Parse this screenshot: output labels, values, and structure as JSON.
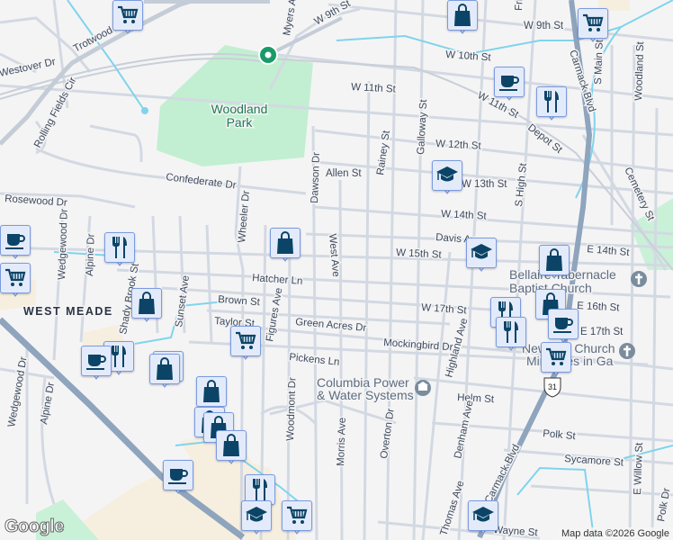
{
  "map": {
    "park_name_line1": "Woodland",
    "park_name_line2": "Park",
    "area_name": "WEST MEADE",
    "poi": {
      "power_line1": "Columbia Power",
      "power_line2": "& Water Systems",
      "church1_line1": "Bellaire Tabernacle",
      "church1_line2": "Baptist Church",
      "church2_line1": "New Life Church",
      "church2_line2": "Ministries in Ga"
    },
    "route_shield": "31",
    "streets": {
      "trotwood": "Trotwood Ave",
      "westover": "Westover Dr",
      "myers": "Myers Ave",
      "w9th": "W 9th St",
      "w9th_e": "W 9th St",
      "w10th": "W 10th St",
      "w11th": "W 11th St",
      "w11th_b": "W 11th St",
      "w12th": "W 12th St",
      "w13th": "W 13th St",
      "w14th": "W 14th St",
      "w15th": "W 15th St",
      "w17th": "W 17th St",
      "e14th": "E 14th St",
      "e16th": "E 16th St",
      "e17th": "E 17th St",
      "rolling": "Rolling Fields Cir",
      "confederate": "Confederate Dr",
      "rosewood": "Rosewood Dr",
      "wheeler": "Wheeler Dr",
      "dawson": "Dawson Dr",
      "allen": "Allen St",
      "rainey": "Rainey St",
      "galloway": "Galloway St",
      "depot": "Depot St",
      "carmack": "Carmack Blvd",
      "carmack2": "Carmack Blvd",
      "smain": "S Main St",
      "woodland": "Woodland St",
      "cemetery": "Cemetery St",
      "shigh": "S High St",
      "davis": "Davis Ave",
      "westave": "West Ave",
      "hatcher": "Hatcher Ln",
      "brown": "Brown St",
      "taylor": "Taylor St",
      "greenacres": "Green Acres Dr",
      "figures": "Figures Ave",
      "sunset": "Sunset Ave",
      "shadybrook": "Shady Brook St",
      "wedgewood": "Wedgewood Dr",
      "wedgewood2": "Wedgewood Dr",
      "alpine": "Alpine Dr",
      "alpine2": "Alpine Dr",
      "pickens": "Pickens Ln",
      "woodmont": "Woodmont Dr",
      "mockingbird": "Mockingbird Dr",
      "highland": "Highland Ave",
      "helm": "Helm St",
      "morris": "Morris Ave",
      "overton": "Overton Dr",
      "denham": "Denham Ave",
      "thomas": "Thomas Ave",
      "polk": "Polk St",
      "sycamore": "Sycamore St",
      "ewillow": "E Willow St",
      "polkdr": "Polk Dr",
      "wayne": "Wayne St",
      "frierson": "Frierson St"
    }
  },
  "attribution": "Map data ©2026 Google",
  "logo": "Google",
  "colors": {
    "background": "#f5f4f5",
    "park": "#c2efd1",
    "water": "#7fd4ec",
    "highway": "#8fa4bd",
    "road": "#d3d9e2",
    "marker_icon": "#0b4466",
    "marker_bg": "#e3ebfb"
  }
}
